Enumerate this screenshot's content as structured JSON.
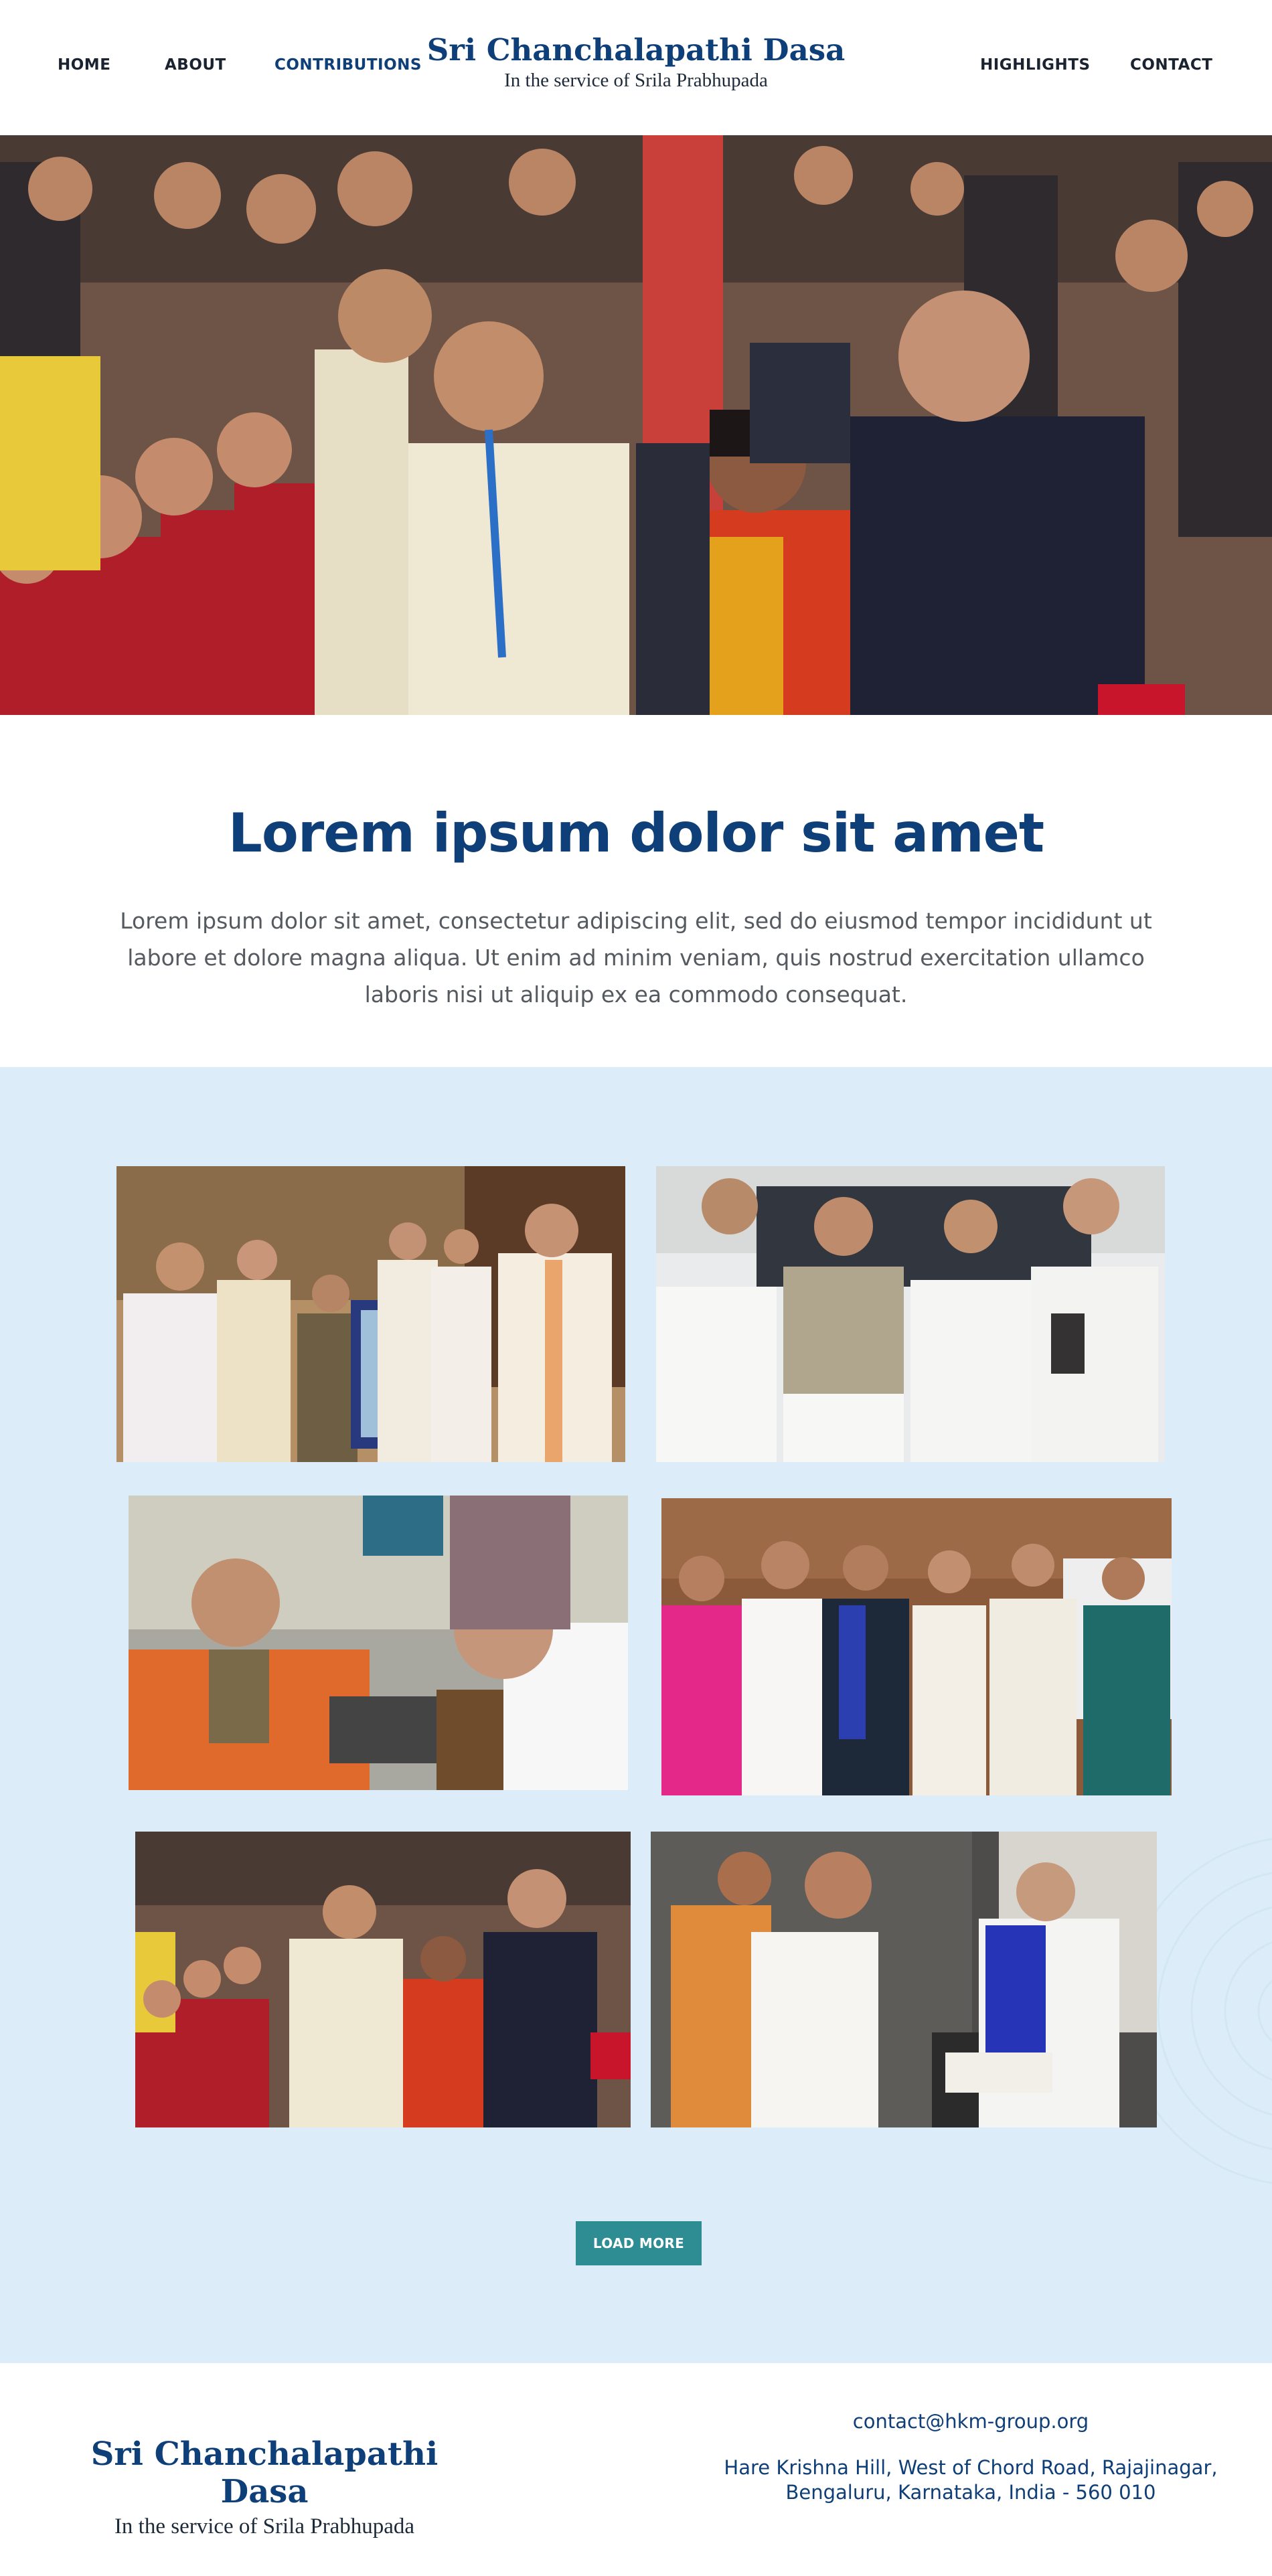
{
  "nav": {
    "home": "HOME",
    "about": "ABOUT",
    "contributions": "CONTRIBUTIONS",
    "highlights": "HIGHLIGHTS",
    "contact": "CONTACT"
  },
  "brand": {
    "name": "Sri Chanchalapathi Dasa",
    "tagline": "In the service of Srila Prabhupada"
  },
  "intro": {
    "title": "Lorem ipsum dolor sit amet",
    "body": "Lorem ipsum dolor sit amet, consectetur adipiscing elit, sed do eiusmod tempor incididunt ut labore et dolore magna aliqua. Ut enim ad minim veniam, quis nostrud exercitation ullamco laboris nisi ut aliquip ex ea commodo consequat."
  },
  "gallery": {
    "load_more": "LOAD MORE"
  },
  "footer": {
    "name": "Sri Chanchalapathi Dasa",
    "tagline": "In the service of Srila Prabhupada",
    "email": "contact@hkm-group.org",
    "address_line1": "Hare Krishna Hill, West of Chord Road, Rajajinagar,",
    "address_line2": "Bengaluru, Karnataka, India - 560 010"
  },
  "colors": {
    "brand_blue": "#0f3f78",
    "gallery_bg": "#dcedf9",
    "button_teal": "#2e8c93",
    "body_text": "#555a60"
  }
}
